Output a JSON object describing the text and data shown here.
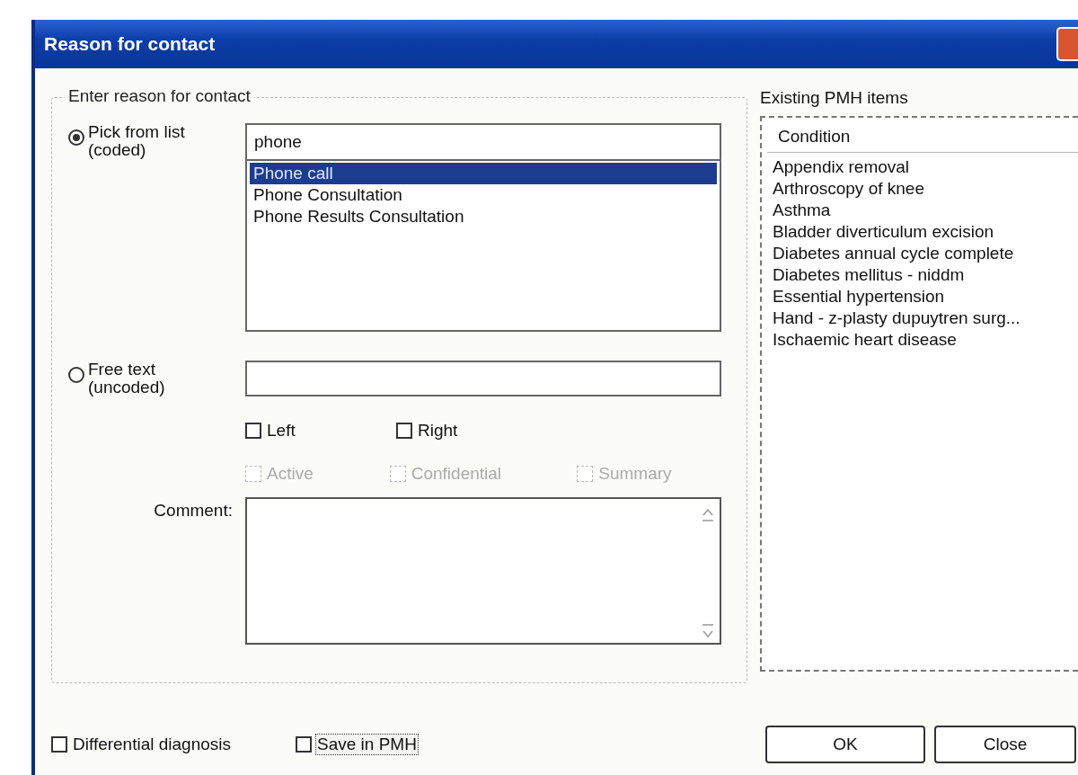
{
  "window": {
    "title": "Reason for contact"
  },
  "reason_group": {
    "title": "Enter reason for contact",
    "pick_option": {
      "label": "Pick from list (coded)",
      "selected": true
    },
    "search_field": {
      "value": "phone"
    },
    "results": [
      {
        "label": "Phone call",
        "selected": true
      },
      {
        "label": "Phone Consultation",
        "selected": false
      },
      {
        "label": "Phone Results Consultation",
        "selected": false
      }
    ],
    "free_option": {
      "label": "Free text (uncoded)",
      "selected": false
    },
    "side_checks": [
      {
        "label": "Left",
        "checked": false,
        "disabled": false
      },
      {
        "label": "Right",
        "checked": false,
        "disabled": false
      }
    ],
    "flag_checks": [
      {
        "label": "Active",
        "checked": false,
        "disabled": true
      },
      {
        "label": "Confidential",
        "checked": false,
        "disabled": true
      },
      {
        "label": "Summary",
        "checked": false,
        "disabled": true
      }
    ],
    "comment_label": "Comment:"
  },
  "pmh_panel": {
    "title": "Existing PMH items",
    "columns": [
      "Condition"
    ],
    "rows": [
      "Appendix removal",
      "Arthroscopy of knee",
      "Asthma",
      "Bladder diverticulum excision",
      "Diabetes annual cycle complete",
      "Diabetes mellitus - niddm",
      "Essential hypertension",
      "Hand - z-plasty dupuytren surg...",
      "Ischaemic heart disease"
    ]
  },
  "bottom_checks": [
    {
      "label": "Differential diagnosis",
      "checked": false,
      "focused": false
    },
    {
      "label": "Save in PMH",
      "checked": false,
      "focused": true
    }
  ],
  "buttons": [
    "OK",
    "Close"
  ]
}
